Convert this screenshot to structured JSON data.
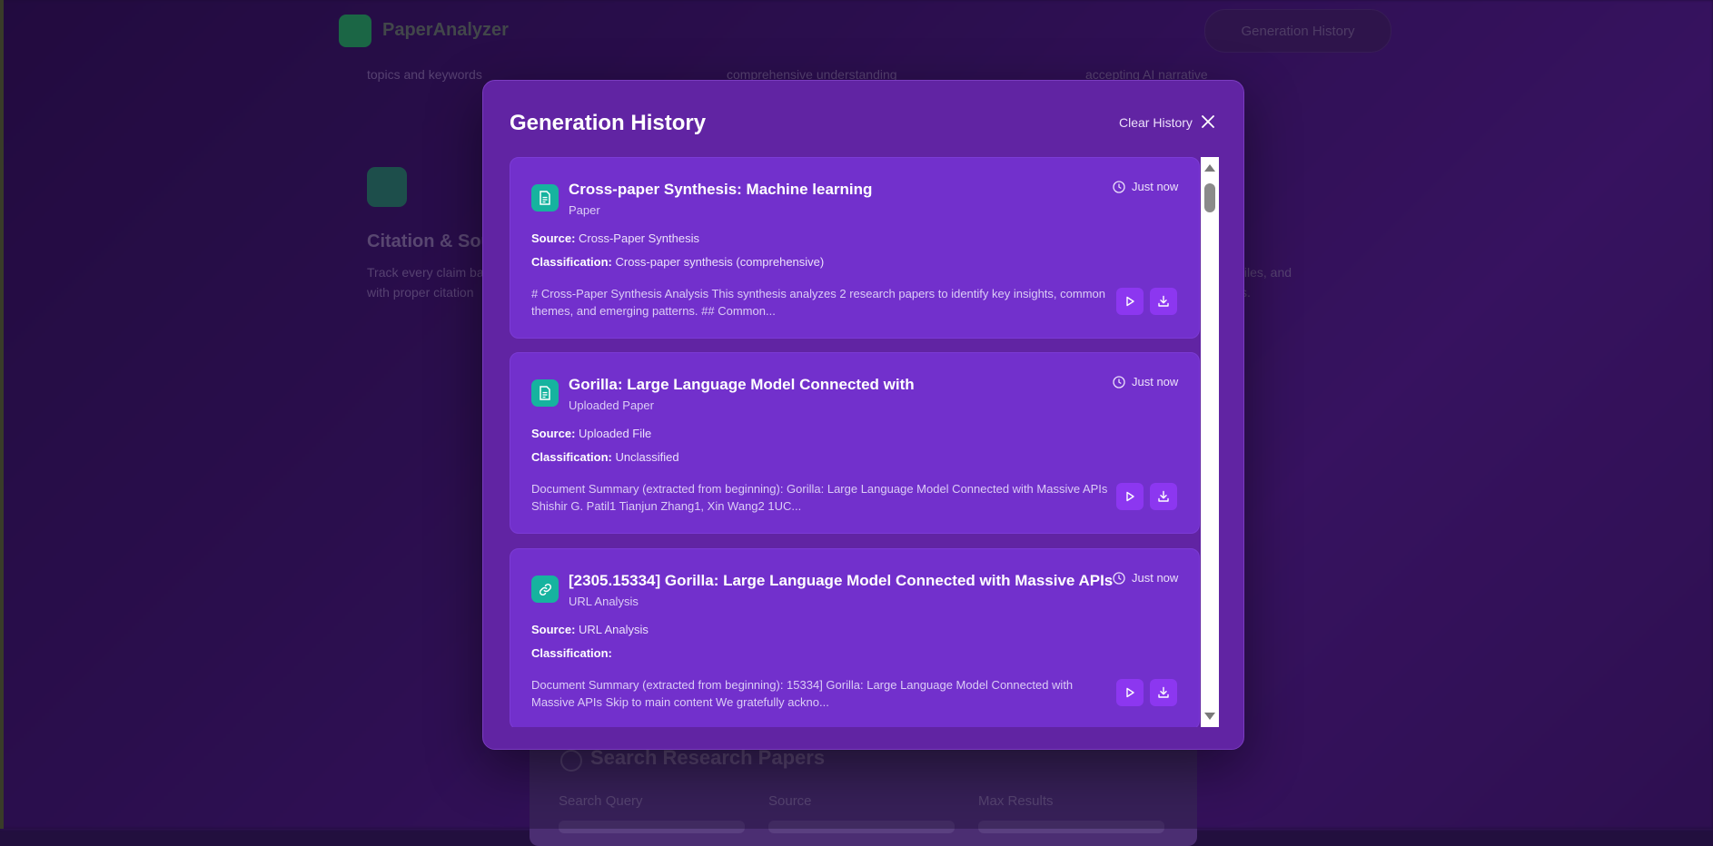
{
  "background": {
    "brand": "PaperAnalyzer",
    "history_button": "Generation History",
    "snippets": [
      "topics and keywords",
      "comprehensive understanding",
      "accepting AI narrative"
    ],
    "card_title": "Citation & Sour",
    "card_desc_1": "Track every claim ba",
    "card_desc_2": "with proper citation",
    "right_desc_1": "files, and",
    "right_desc_2": "s.",
    "search_title": "Search Research Papers",
    "labels": [
      "Search Query",
      "Source",
      "Max Results"
    ]
  },
  "modal": {
    "title": "Generation History",
    "clear_label": "Clear History",
    "items": [
      {
        "icon": "document-icon",
        "title": "Cross-paper Synthesis: Machine learning",
        "type": "Paper",
        "time": "Just now",
        "source_label": "Source:",
        "source": "Cross-Paper Synthesis",
        "classification_label": "Classification:",
        "classification": "Cross-paper synthesis (comprehensive)",
        "preview": "# Cross-Paper Synthesis Analysis This synthesis analyzes 2 research papers to identify key insights, common themes, and emerging patterns. ## Common..."
      },
      {
        "icon": "document-icon",
        "title": "Gorilla: Large Language Model Connected with",
        "type": "Uploaded Paper",
        "time": "Just now",
        "source_label": "Source:",
        "source": "Uploaded File",
        "classification_label": "Classification:",
        "classification": "Unclassified",
        "preview": "Document Summary (extracted from beginning): Gorilla: Large Language Model Connected with Massive APIs Shishir G. Patil1 Tianjun Zhang1, Xin Wang2 1UC..."
      },
      {
        "icon": "link-icon",
        "title": "[2305.15334] Gorilla: Large Language Model Connected with Massive APIs",
        "type": "URL Analysis",
        "time": "Just now",
        "source_label": "Source:",
        "source": "URL Analysis",
        "classification_label": "Classification:",
        "classification": "",
        "preview": "Document Summary (extracted from beginning): 15334] Gorilla: Large Language Model Connected with Massive APIs Skip to main content We gratefully ackno..."
      }
    ]
  },
  "colors": {
    "modal_bg": "#6124a3",
    "card_bg": "#7230cc",
    "icon_teal": "#16b39f",
    "action_purple": "#8c37f0"
  }
}
